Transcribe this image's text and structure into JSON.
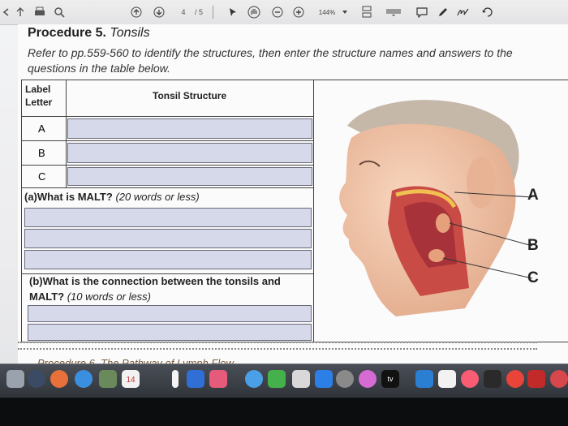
{
  "toolbar": {
    "page_current": "4",
    "page_total": "/ 5",
    "zoom": "144%"
  },
  "document": {
    "title_prefix": "Procedure 5.",
    "title_rest": " Tonsils",
    "instructions": "Refer to pp.559-560 to identify the structures, then enter the structure names and answers to the questions in the table below.",
    "table": {
      "col1_header": "Label Letter",
      "col2_header": "Tonsil Structure",
      "rows": [
        "A",
        "B",
        "C"
      ]
    },
    "question_a_bold": "(a)What is MALT?",
    "question_a_note": "(20 words or less)",
    "question_b_bold": "(b)What is the connection between the tonsils and MALT?",
    "question_b_note": "(10 words or less)",
    "next_section": "Procedure 6. The Pathway of Lymph Flow"
  },
  "figure": {
    "labels": [
      "A",
      "B",
      "C"
    ]
  },
  "dock": {
    "calendar_day": "14",
    "appletv_label": "tv"
  },
  "colors": {
    "answer_box": "#d6d9ea",
    "dock_bg": "#3a3e45"
  }
}
